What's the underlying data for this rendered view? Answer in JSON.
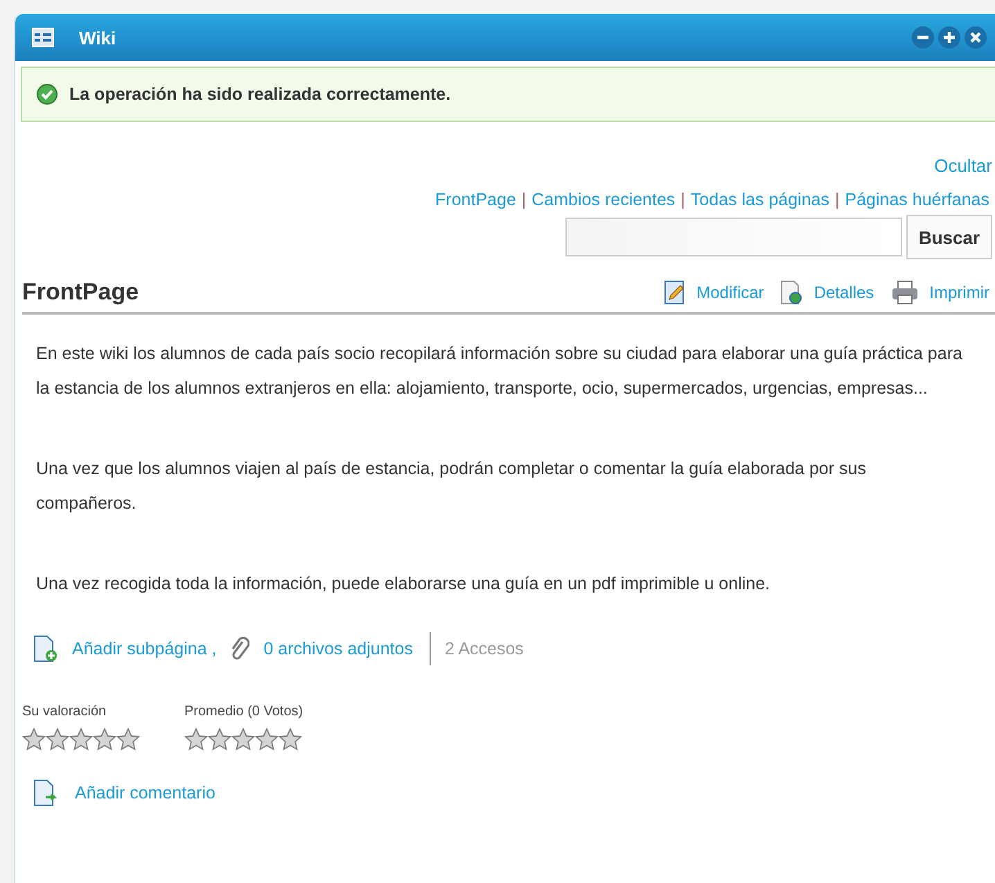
{
  "window": {
    "title": "Wiki"
  },
  "message": {
    "kind": "success",
    "text": "La operación ha sido realizada correctamente."
  },
  "hide_link": "Ocultar",
  "nav_links": [
    {
      "kind": "link",
      "text": "FrontPage"
    },
    {
      "kind": "separator",
      "text": "|"
    },
    {
      "kind": "link",
      "text": "Cambios recientes"
    },
    {
      "kind": "separator",
      "text": "|"
    },
    {
      "kind": "link",
      "text": "Todas las páginas"
    },
    {
      "kind": "separator",
      "text": "|"
    },
    {
      "kind": "link",
      "text": "Páginas huérfanas"
    }
  ],
  "search": {
    "button": "Buscar"
  },
  "page": {
    "title": "FrontPage",
    "actions": [
      {
        "kind": "edit",
        "label": "Modificar"
      },
      {
        "kind": "details",
        "label": "Detalles"
      },
      {
        "kind": "print",
        "label": "Imprimir"
      }
    ],
    "paragraphs": [
      "En este wiki los alumnos de cada país socio recopilará información sobre su ciudad para elaborar una guía práctica para la estancia de los alumnos extranjeros en ella: alojamiento, transporte, ocio, supermercados, urgencias, empresas...",
      "Una vez que los alumnos viajen al país de estancia, podrán completar o comentar la guía elaborada por sus compañeros.",
      "Una vez recogida toda la información, puede elaborarse una guía en un pdf imprimible u online."
    ]
  },
  "footer": {
    "add_subpage": "Añadir subpágina ,",
    "attachments": "0 archivos adjuntos",
    "hits": "2 Accesos"
  },
  "ratings": [
    {
      "label": "Su valoración",
      "stars": 0
    },
    {
      "label": "Promedio (0 Votos)",
      "stars": 0
    }
  ],
  "add_comment": "Añadir comentario"
}
